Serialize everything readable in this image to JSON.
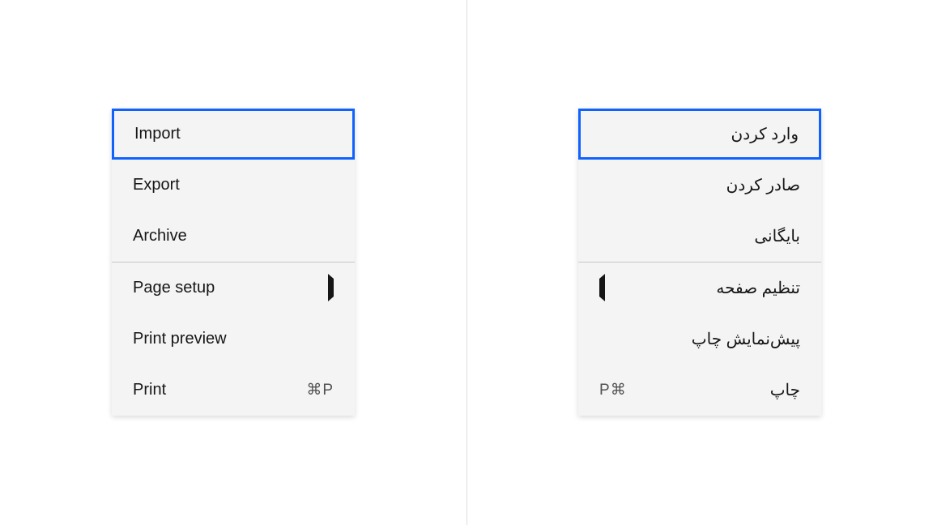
{
  "menu_ltr": {
    "items": [
      {
        "label": "Import",
        "focused": true
      },
      {
        "label": "Export"
      },
      {
        "label": "Archive"
      },
      {
        "divider": true
      },
      {
        "label": "Page setup",
        "submenu": true
      },
      {
        "label": "Print preview"
      },
      {
        "label": "Print",
        "shortcut": "⌘P"
      }
    ]
  },
  "menu_rtl": {
    "items": [
      {
        "label": "وارد کردن",
        "focused": true
      },
      {
        "label": "صادر کردن"
      },
      {
        "label": "بایگانی"
      },
      {
        "divider": true
      },
      {
        "label": "تنظیم صفحه",
        "submenu": true
      },
      {
        "label": "پیش‌نمایش چاپ"
      },
      {
        "label": "چاپ",
        "shortcut": "⌘P"
      }
    ]
  }
}
